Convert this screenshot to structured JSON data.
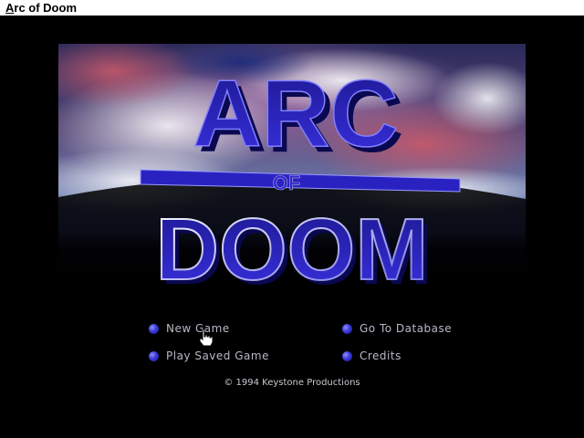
{
  "window": {
    "title_mnemonic": "A",
    "title_rest": "rc of Doom"
  },
  "logo": {
    "line1": "ARC",
    "line2": "OF",
    "line3": "DOOM"
  },
  "menu": {
    "new_game": "New Game",
    "play_saved_game": "Play Saved Game",
    "go_to_database": "Go To Database",
    "credits": "Credits"
  },
  "footer": {
    "copyright": "© 1994 Keystone Productions"
  },
  "colors": {
    "logo_blue": "#2c22c8",
    "menu_orb": "#3a3ad8",
    "menu_text": "#b8b8c8"
  },
  "icons": {
    "cursor": "hand-pointer-icon",
    "menu_bullet": "blue-orb-icon"
  }
}
